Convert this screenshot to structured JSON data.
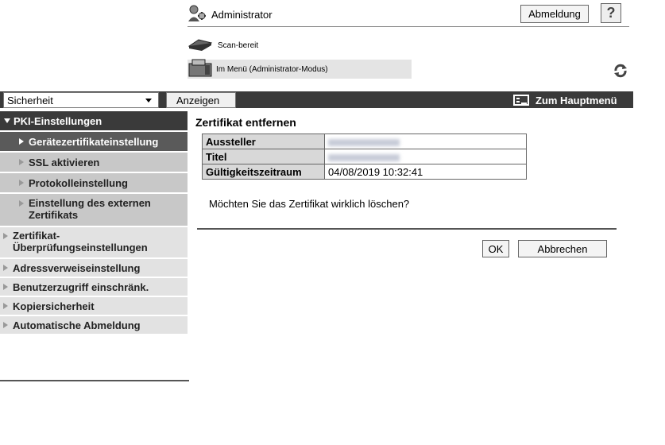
{
  "header": {
    "user_label": "Administrator",
    "logout_label": "Abmeldung",
    "help_label": "?",
    "status_label": "Scan-bereit",
    "mode_label": "Im Menü (Administrator-Modus)"
  },
  "toolbar": {
    "category_value": "Sicherheit",
    "show_label": "Anzeigen",
    "main_menu_label": "Zum Hauptmenü"
  },
  "sidebar": {
    "section_title": "PKI-Einstellungen",
    "sub_items": [
      {
        "label": "Gerätezertifikateinstellung"
      },
      {
        "label": "SSL aktivieren"
      },
      {
        "label": "Protokolleinstellung"
      },
      {
        "label": "Einstellung des externen Zertifikats"
      }
    ],
    "main_items": [
      {
        "label": "Zertifikat-Überprüfungseinstellungen"
      },
      {
        "label": "Adressverweiseinstellung"
      },
      {
        "label": "Benutzerzugriff einschränk."
      },
      {
        "label": "Kopiersicherheit"
      },
      {
        "label": "Automatische Abmeldung"
      }
    ]
  },
  "content": {
    "title": "Zertifikat entfernen",
    "rows": [
      {
        "key": "Aussteller",
        "value": ""
      },
      {
        "key": "Titel",
        "value": ""
      },
      {
        "key": "Gültigkeitszeitraum",
        "value": "04/08/2019 10:32:41"
      }
    ],
    "question": "Möchten Sie das Zertifikat wirklich löschen?",
    "ok_label": "OK",
    "cancel_label": "Abbrechen"
  },
  "icons": {
    "admin": "admin-user-icon",
    "scanner": "scanner-icon",
    "printer": "printer-icon",
    "refresh": "refresh-icon",
    "main_menu": "main-menu-icon",
    "dropdown": "chevron-down-icon"
  }
}
